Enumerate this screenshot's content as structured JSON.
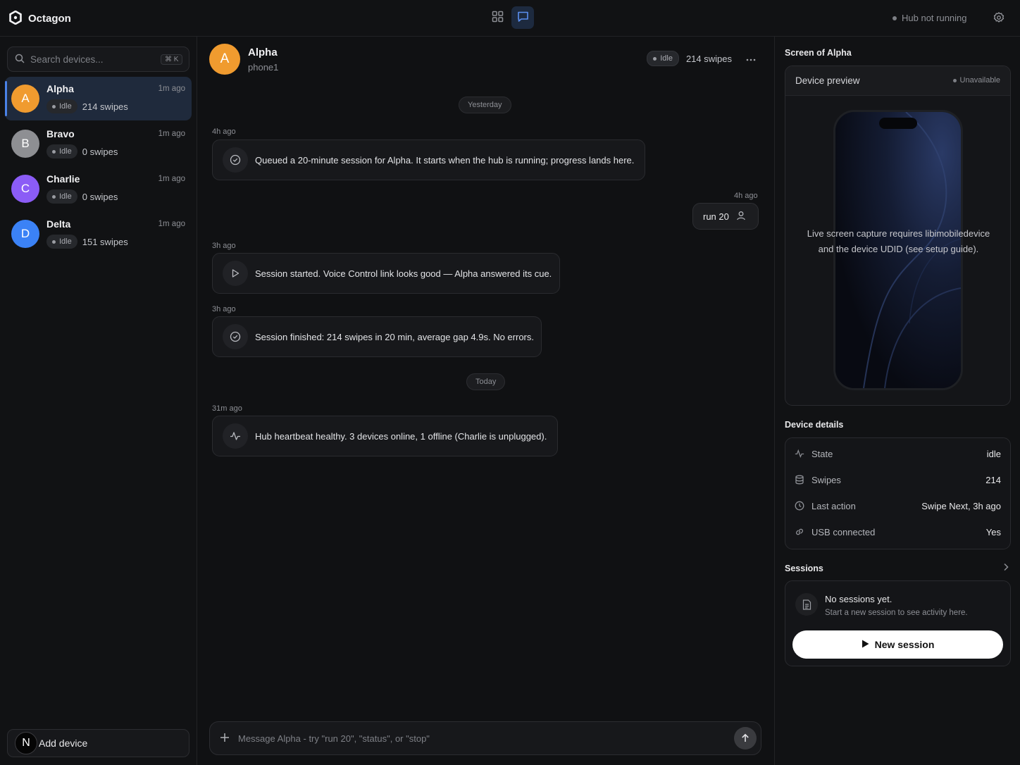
{
  "app": {
    "name": "Octagon"
  },
  "topbar": {
    "hub_status": "Hub not running"
  },
  "sidebar": {
    "search_placeholder": "Search devices...",
    "search_shortcut": "⌘ K",
    "devices": [
      {
        "initial": "A",
        "name": "Alpha",
        "time": "1m ago",
        "status": "Idle",
        "swipes": "214 swipes",
        "color": "#f09b2f",
        "selected": true
      },
      {
        "initial": "B",
        "name": "Bravo",
        "time": "1m ago",
        "status": "Idle",
        "swipes": "0 swipes",
        "color": "#8e8f93",
        "selected": false
      },
      {
        "initial": "C",
        "name": "Charlie",
        "time": "1m ago",
        "status": "Idle",
        "swipes": "0 swipes",
        "color": "#8b5cf6",
        "selected": false
      },
      {
        "initial": "D",
        "name": "Delta",
        "time": "1m ago",
        "status": "Idle",
        "swipes": "151 swipes",
        "color": "#3b82f6",
        "selected": false
      }
    ],
    "add_device_initial": "N",
    "add_device_label": "Add device"
  },
  "chat": {
    "header": {
      "initial": "A",
      "title": "Alpha",
      "subtitle": "phone1",
      "status": "Idle",
      "swipes": "214 swipes"
    },
    "day_yesterday": "Yesterday",
    "day_today": "Today",
    "messages": [
      {
        "time": "4h ago",
        "icon": "check-circle-icon",
        "text": "Queued a 20-minute session for Alpha. It starts when the hub is running; progress lands here."
      },
      {
        "time": "3h ago",
        "icon": "play-icon",
        "text": "Session started. Voice Control link looks good — Alpha answered its cue."
      },
      {
        "time": "3h ago",
        "icon": "check-circle-icon",
        "text": "Session finished: 214 swipes in 20 min, average gap 4.9s. No errors."
      },
      {
        "time": "31m ago",
        "icon": "activity-icon",
        "text": "Hub heartbeat healthy. 3 devices online, 1 offline (Charlie is unplugged)."
      }
    ],
    "user_message": {
      "time": "4h ago",
      "text": "run 20"
    },
    "composer_placeholder": "Message Alpha - try \"run 20\", \"status\", or \"stop\""
  },
  "panel": {
    "screen_title": "Screen of Alpha",
    "preview_title": "Device preview",
    "preview_status": "Unavailable",
    "preview_message": "Live screen capture requires libimobiledevice and the device UDID (see setup guide).",
    "details_title": "Device details",
    "details": [
      {
        "icon": "activity-icon",
        "key": "State",
        "value": "idle"
      },
      {
        "icon": "database-icon",
        "key": "Swipes",
        "value": "214"
      },
      {
        "icon": "clock-icon",
        "key": "Last action",
        "value": "Swipe Next, 3h ago"
      },
      {
        "icon": "link-icon",
        "key": "USB connected",
        "value": "Yes"
      }
    ],
    "sessions_title": "Sessions",
    "sessions_empty_title": "No sessions yet.",
    "sessions_empty_sub": "Start a new session to see activity here.",
    "new_session_label": "New session"
  }
}
